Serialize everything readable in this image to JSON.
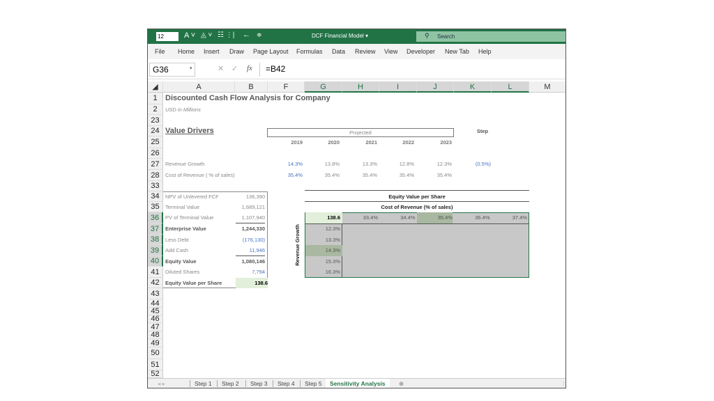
{
  "title_bar": {
    "font_size": "12",
    "doc_title": "DCF Financial Model",
    "search_placeholder": "Search"
  },
  "ribbon_tabs": [
    "File",
    "Home",
    "Insert",
    "Draw",
    "Page Layout",
    "Formulas",
    "Data",
    "Review",
    "View",
    "Developer",
    "New Tab",
    "Help"
  ],
  "formula_bar": {
    "name_box": "G36",
    "formula": "=B42"
  },
  "columns": [
    "A",
    "B",
    "F",
    "G",
    "H",
    "I",
    "J",
    "K",
    "L",
    "M"
  ],
  "rows": [
    "1",
    "2",
    "23",
    "24",
    "25",
    "26",
    "27",
    "28",
    "33",
    "34",
    "35",
    "36",
    "37",
    "38",
    "39",
    "40",
    "41",
    "42",
    "43",
    "44",
    "45",
    "46",
    "47",
    "48",
    "49",
    "50",
    "51",
    "52"
  ],
  "sheet": {
    "title": "Discounted Cash Flow Analysis for Company",
    "subtitle": "USD in Millions",
    "value_drivers": "Value Drivers",
    "projected": "Projected",
    "step": "Step",
    "years": [
      "2019",
      "2020",
      "2021",
      "2022",
      "2023"
    ],
    "revenue_growth": {
      "label": "Revenue Growth",
      "values": [
        "14.3%",
        "13.8%",
        "13.3%",
        "12.8%",
        "12.3%"
      ],
      "step": "(0.5%)"
    },
    "cost_of_revenue": {
      "label": "Cost of Revenue ( % of sales)",
      "values": [
        "35.4%",
        "35.4%",
        "35.4%",
        "35.4%",
        "35.4%"
      ]
    },
    "valuation": [
      {
        "label": "NPV of Unlevered FCF",
        "value": "136,390"
      },
      {
        "label": "Terminal Value",
        "value": "1,689,121"
      },
      {
        "label": "PV of Terminal Value",
        "value": "1,107,940"
      },
      {
        "label": "Enterprise Value",
        "value": "1,244,330"
      },
      {
        "label": "Less Debt",
        "value": "(176,130)"
      },
      {
        "label": "Add Cash",
        "value": "11,946"
      },
      {
        "label": "Equity Value",
        "value": "1,080,146"
      },
      {
        "label": "Diluted Shares",
        "value": "7,794"
      },
      {
        "label": "Equity Value per Share",
        "value": "138.6"
      }
    ],
    "sensitivity": {
      "title": "Equity Value per Share",
      "col_title": "Cost of Revenue (% of sales)",
      "row_title": "Revenue Growth",
      "corner": "138.6",
      "col_values": [
        "33.4%",
        "34.4%",
        "35.4%",
        "36.4%",
        "37.4%"
      ],
      "row_values": [
        "12.3%",
        "13.3%",
        "14.3%",
        "15.3%",
        "16.3%"
      ]
    }
  },
  "sheet_tabs": [
    "Step 1",
    "Step 2",
    "Step 3",
    "Step 4",
    "Step 5",
    "Sensitivity Analysis"
  ],
  "active_tab": "Sensitivity Analysis",
  "colors": {
    "accent": "#217346",
    "input_blue": "#4472c4",
    "table_gray": "#c8c8c8",
    "highlight": "#e2efda"
  }
}
